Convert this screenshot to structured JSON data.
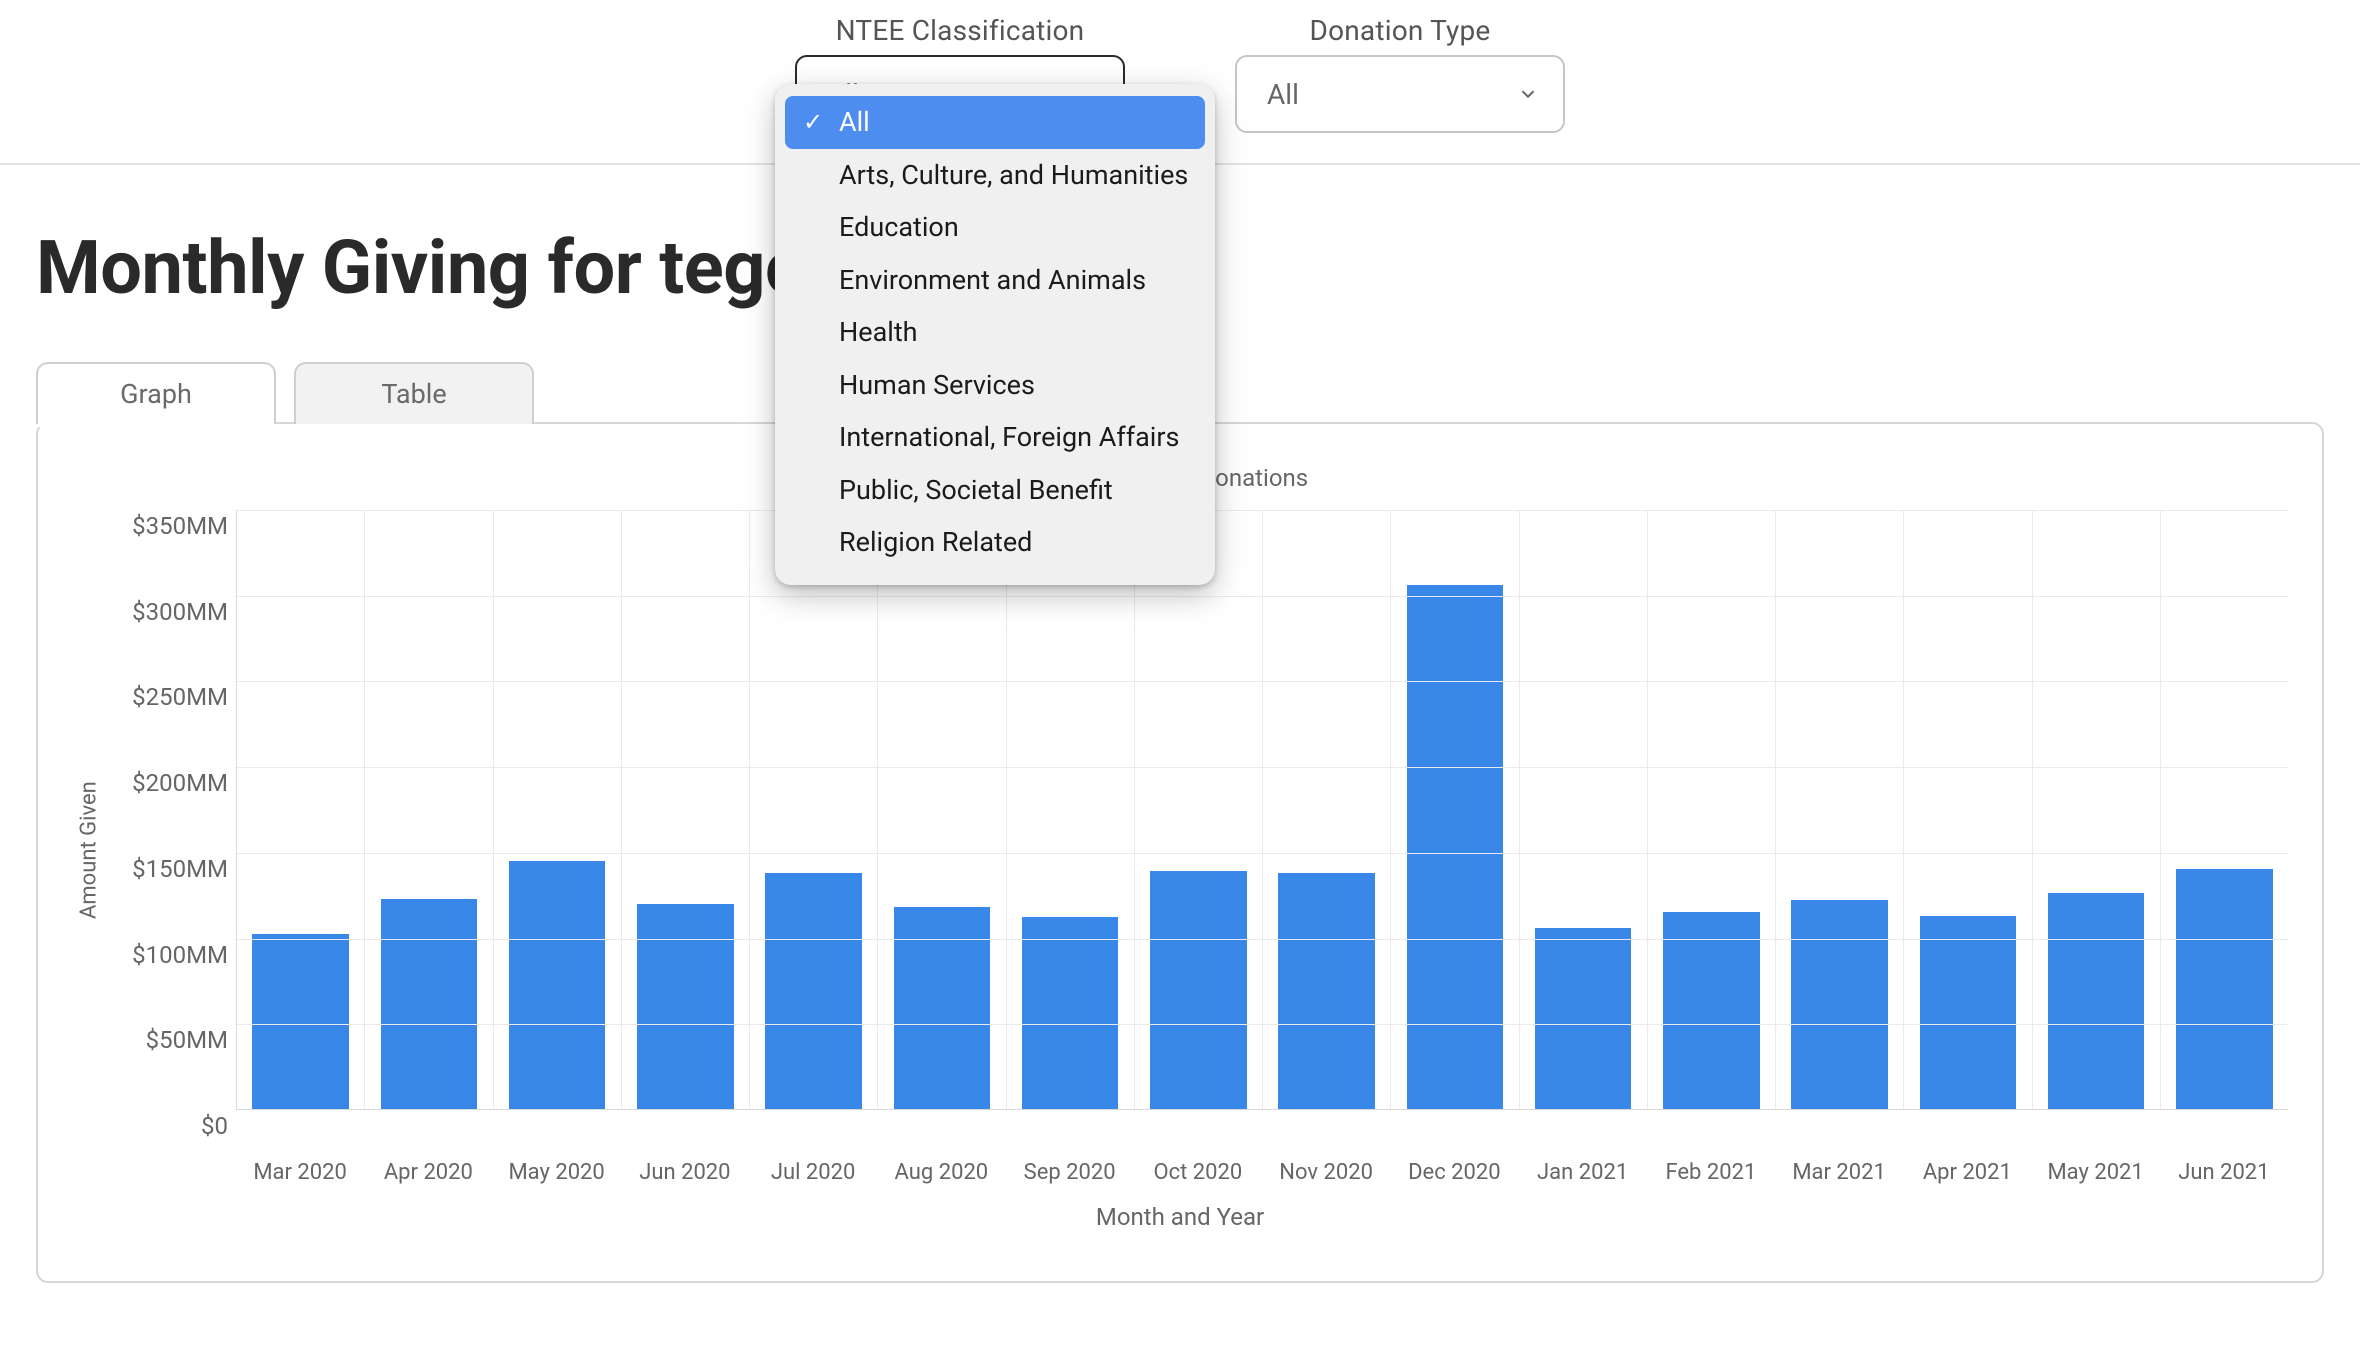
{
  "filters": {
    "ntee": {
      "label": "NTEE Classification",
      "value": "All",
      "options": [
        "All",
        "Arts, Culture, and Humanities",
        "Education",
        "Environment and Animals",
        "Health",
        "Human Services",
        "International, Foreign Affairs",
        "Public, Societal Benefit",
        "Religion Related"
      ],
      "selected_index": 0
    },
    "donation_type": {
      "label": "Donation Type",
      "value": "All"
    }
  },
  "page_title": "Monthly Giving for                                         tegories",
  "tabs": {
    "graph": "Graph",
    "table": "Table",
    "active": "graph"
  },
  "legend": {
    "series_label": "Total Donations"
  },
  "chart_data": {
    "type": "bar",
    "title": "",
    "xlabel": "Month and Year",
    "ylabel": "Amount Given",
    "ylim": [
      0,
      350
    ],
    "y_ticks": [
      0,
      50,
      100,
      150,
      200,
      250,
      300,
      350
    ],
    "y_tick_labels": [
      "$0",
      "$50MM",
      "$100MM",
      "$150MM",
      "$200MM",
      "$250MM",
      "$300MM",
      "$350MM"
    ],
    "categories": [
      "Mar 2020",
      "Apr 2020",
      "May 2020",
      "Jun 2020",
      "Jul 2020",
      "Aug 2020",
      "Sep 2020",
      "Oct 2020",
      "Nov 2020",
      "Dec 2020",
      "Jan 2021",
      "Feb 2021",
      "Mar 2021",
      "Apr 2021",
      "May 2021",
      "Jun 2021"
    ],
    "series": [
      {
        "name": "Total Donations",
        "color": "#3a87ea",
        "values": [
          102,
          123,
          145,
          120,
          138,
          118,
          112,
          139,
          138,
          306,
          106,
          115,
          122,
          113,
          126,
          140
        ]
      }
    ]
  }
}
